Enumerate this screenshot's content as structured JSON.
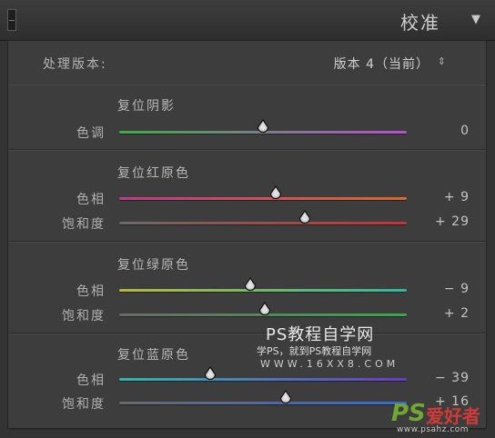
{
  "panel": {
    "title": "校准",
    "collapse_icon": "collapse-square-icon",
    "menu_icon": "triangle-down-icon"
  },
  "process": {
    "label": "处理版本:",
    "value": "版本 4（当前）",
    "arrows": "⇕"
  },
  "sections": [
    {
      "title": "复位阴影",
      "rows": [
        {
          "label": "色调",
          "value": "0",
          "position": 0.5,
          "gradient": [
            "#3cae45",
            "#b84fd0"
          ]
        }
      ]
    },
    {
      "title": "复位红原色",
      "rows": [
        {
          "label": "色相",
          "value": "+ 9",
          "position": 0.545,
          "gradient": [
            "#c0398a",
            "#d96a2a"
          ]
        },
        {
          "label": "饱和度",
          "value": "+ 29",
          "position": 0.645,
          "gradient": [
            "#6a6a6a",
            "#c8323a"
          ]
        }
      ]
    },
    {
      "title": "复位绿原色",
      "rows": [
        {
          "label": "色相",
          "value": "− 9",
          "position": 0.455,
          "gradient": [
            "#b8b83a",
            "#2fb8a0"
          ]
        },
        {
          "label": "饱和度",
          "value": "+ 2",
          "position": 0.505,
          "gradient": [
            "#6a6a6a",
            "#3aa84a"
          ]
        }
      ]
    },
    {
      "title": "复位蓝原色",
      "rows": [
        {
          "label": "色相",
          "value": "− 39",
          "position": 0.315,
          "gradient": [
            "#2fb8b0",
            "#6a3ac8"
          ]
        },
        {
          "label": "饱和度",
          "value": "+ 16",
          "position": 0.58,
          "gradient": [
            "#6a6a6a",
            "#3a6ad0"
          ]
        }
      ]
    }
  ],
  "watermark": {
    "main": "PS教程自学网",
    "sub": "学PS，就到PS教程自学网",
    "url": "WWW.16XX8.COM"
  },
  "brand": {
    "ps": "PS",
    "cn": "爱好者",
    "url": "www.psahz.com"
  }
}
